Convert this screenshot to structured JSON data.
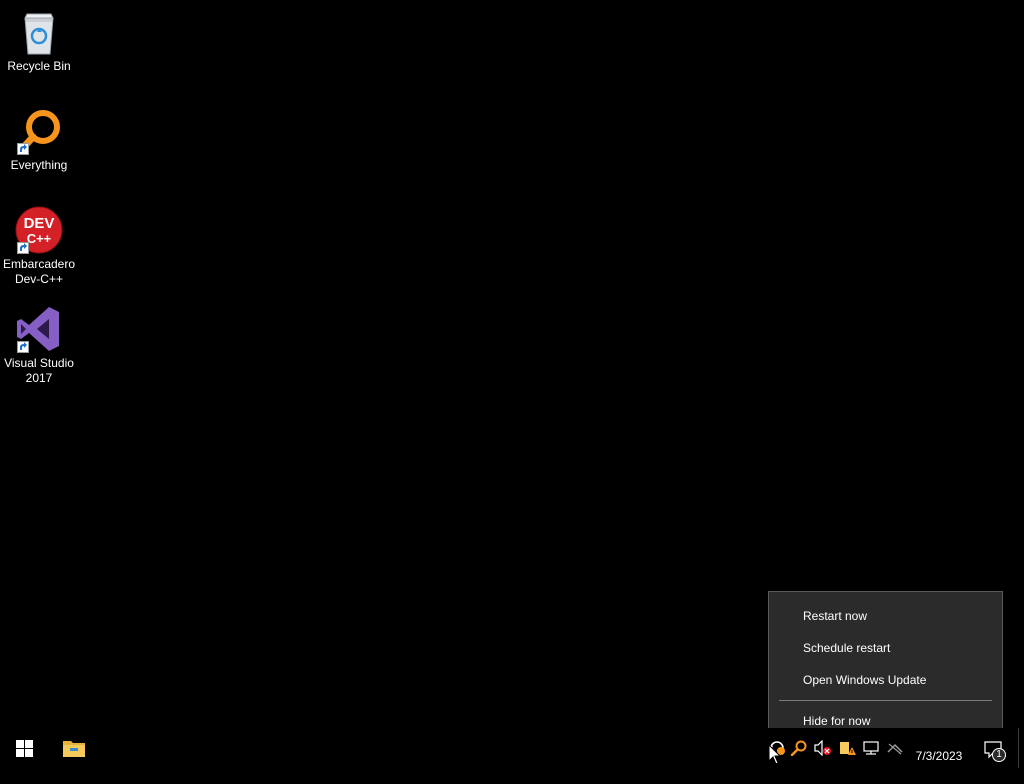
{
  "desktop": {
    "icons": [
      {
        "label": "Recycle Bin",
        "icon": "recycle-bin-icon"
      },
      {
        "label": "Everything",
        "icon": "everything-search-icon",
        "shortcut": true
      },
      {
        "label": "Embarcadero\nDev-C++",
        "icon": "dev-cpp-icon",
        "shortcut": true,
        "icon_text_1": "DEV",
        "icon_text_2": "C++"
      },
      {
        "label": "Visual Studio\n2017",
        "icon": "visual-studio-icon",
        "shortcut": true
      }
    ]
  },
  "context_menu": {
    "items": [
      {
        "label": "Restart now"
      },
      {
        "label": "Schedule restart"
      },
      {
        "label": "Open Windows Update"
      },
      {
        "label": "Hide for now"
      }
    ]
  },
  "taskbar": {
    "start_icon": "windows-logo-icon",
    "pinned": [
      {
        "name": "File Explorer",
        "icon": "folder-icon"
      }
    ],
    "tray_icons": [
      "windows-update-icon",
      "everything-tray-icon",
      "volume-muted-icon",
      "security-warning-icon",
      "network-icon",
      "hidden-icons-icon"
    ],
    "clock_date": "7/3/2023",
    "notification_count": "1"
  },
  "colors": {
    "desktop_background": "#000000",
    "menu_background": "#2b2b2b",
    "everything_orange": "#f7941d",
    "devcpp_red": "#d42027",
    "vs_purple": "#865fc5",
    "windows_blue": "#0078d7"
  }
}
